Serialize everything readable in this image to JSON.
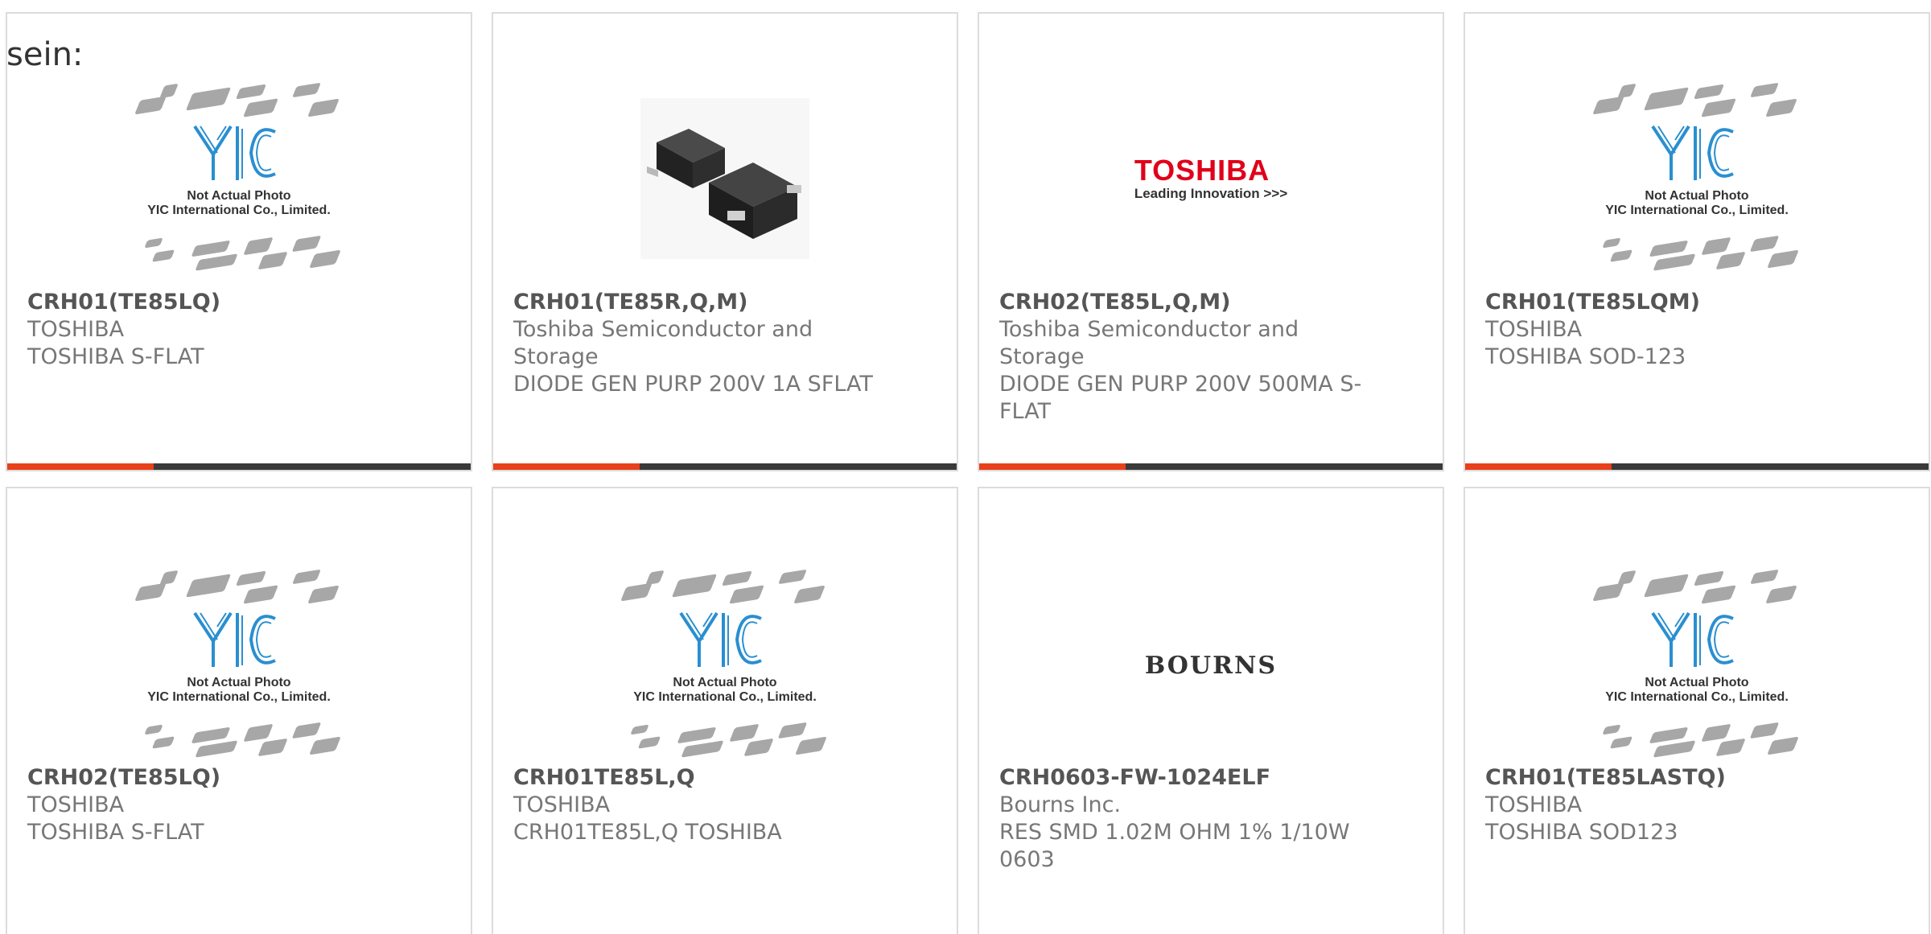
{
  "heading": "sein:",
  "placeholder": {
    "caption1": "Not Actual Photo",
    "caption2": "YIC International Co., Limited."
  },
  "logos": {
    "toshiba_brand": "TOSHIBA",
    "toshiba_tagline": "Leading Innovation >>>",
    "bourns": "BOURNS"
  },
  "colors": {
    "accent": "#e8401a",
    "bar": "#3a3a3a",
    "toshiba_red": "#e0001a",
    "yic_blue": "#2a8fd0"
  },
  "products": [
    {
      "part_number": "CRH01(TE85LQ)",
      "manufacturer": "TOSHIBA",
      "description": "TOSHIBA S-FLAT",
      "image": "yic-placeholder"
    },
    {
      "part_number": "CRH01(TE85R,Q,M)",
      "manufacturer": "Toshiba Semiconductor and Storage",
      "description": "DIODE GEN PURP 200V 1A SFLAT",
      "image": "diode-photo"
    },
    {
      "part_number": "CRH02(TE85L,Q,M)",
      "manufacturer": "Toshiba Semiconductor and Storage",
      "description": "DIODE GEN PURP 200V 500MA S-FLAT",
      "image": "toshiba-logo"
    },
    {
      "part_number": "CRH01(TE85LQM)",
      "manufacturer": "TOSHIBA",
      "description": "TOSHIBA SOD-123",
      "image": "yic-placeholder"
    },
    {
      "part_number": "CRH02(TE85LQ)",
      "manufacturer": "TOSHIBA",
      "description": "TOSHIBA S-FLAT",
      "image": "yic-placeholder"
    },
    {
      "part_number": "CRH01TE85L,Q",
      "manufacturer": "TOSHIBA",
      "description": "CRH01TE85L,Q TOSHIBA",
      "image": "yic-placeholder"
    },
    {
      "part_number": "CRH0603-FW-1024ELF",
      "manufacturer": "Bourns Inc.",
      "description": "RES SMD 1.02M OHM 1% 1/10W 0603",
      "image": "bourns-logo"
    },
    {
      "part_number": "CRH01(TE85LASTQ)",
      "manufacturer": "TOSHIBA",
      "description": "TOSHIBA SOD123",
      "image": "yic-placeholder"
    }
  ]
}
